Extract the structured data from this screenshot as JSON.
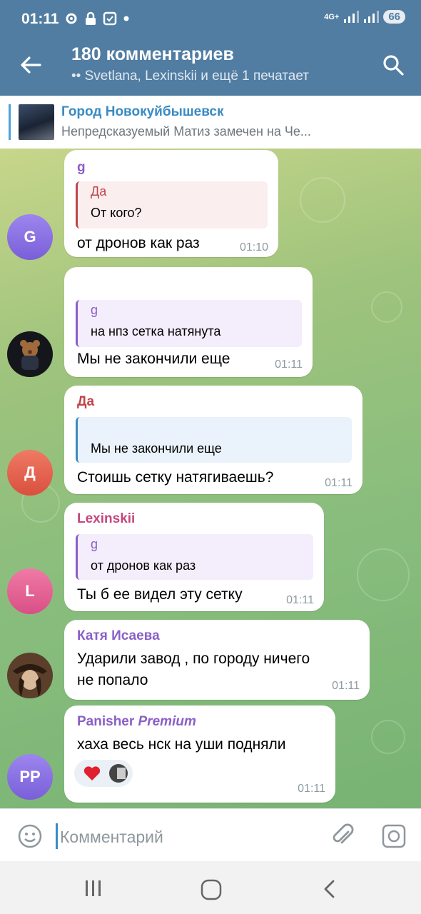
{
  "status_bar": {
    "time": "01:11",
    "network": "4G+",
    "battery": "66"
  },
  "header": {
    "title": "180 комментариев",
    "subtitle": "•• Svetlana, Lexinskii и ещё 1 печатает"
  },
  "pinned": {
    "title": "Город Новокуйбышевск",
    "text": "Непредсказуемый Матиз замечен на Че..."
  },
  "messages": [
    {
      "sender": "g",
      "avatar": "G",
      "quote_name": "Да",
      "quote_text": "От кого?",
      "text": "от дронов как раз",
      "time": "01:10"
    },
    {
      "sender": "",
      "quote_name": "g",
      "quote_text": "на нпз сетка натянута",
      "text": "Мы не закончили еще",
      "time": "01:11"
    },
    {
      "sender": "Да",
      "avatar": "Д",
      "quote_name": "",
      "quote_text": "Мы не закончили еще",
      "text": "Стоишь сетку натягиваешь?",
      "time": "01:11"
    },
    {
      "sender": "Lexinskii",
      "avatar": "L",
      "quote_name": "g",
      "quote_text": "от дронов как раз",
      "text": "Ты б ее видел эту сетку",
      "time": "01:11"
    },
    {
      "sender": "Катя Исаева",
      "text_line1": "Ударили завод , по городу ничего",
      "text_line2": "не попало",
      "time": "01:11"
    },
    {
      "sender": "Panisher",
      "badge": "Premium",
      "avatar": "PP",
      "text": "хаха весь нск на уши подняли",
      "time": "01:11",
      "reaction": "heart"
    }
  ],
  "input": {
    "placeholder": "Комментарий"
  },
  "colors": {
    "header": "#517da2",
    "accent": "#3a8bc4"
  }
}
